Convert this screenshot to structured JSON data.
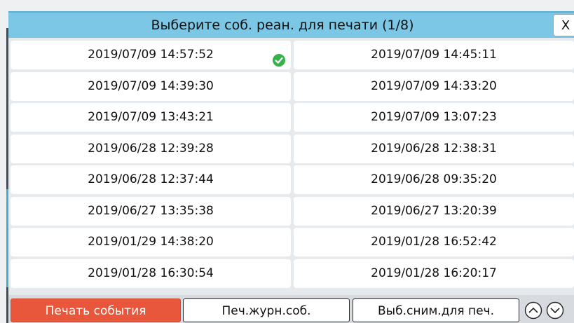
{
  "title": "Выберите соб. реан. для печати (1/8)",
  "close_label": "X",
  "events": [
    {
      "time": "2019/07/09 14:57:52",
      "selected": true
    },
    {
      "time": "2019/07/09 14:45:11",
      "selected": false
    },
    {
      "time": "2019/07/09 14:39:30",
      "selected": false
    },
    {
      "time": "2019/07/09 14:33:20",
      "selected": false
    },
    {
      "time": "2019/07/09 13:43:21",
      "selected": false
    },
    {
      "time": "2019/07/09 13:07:23",
      "selected": false
    },
    {
      "time": "2019/06/28 12:39:28",
      "selected": false
    },
    {
      "time": "2019/06/28 12:38:31",
      "selected": false
    },
    {
      "time": "2019/06/28 12:37:44",
      "selected": false
    },
    {
      "time": "2019/06/28 09:35:20",
      "selected": false
    },
    {
      "time": "2019/06/27 13:35:38",
      "selected": false
    },
    {
      "time": "2019/06/27 13:20:39",
      "selected": false
    },
    {
      "time": "2019/01/29 14:38:20",
      "selected": false
    },
    {
      "time": "2019/01/28 16:52:42",
      "selected": false
    },
    {
      "time": "2019/01/28 16:30:54",
      "selected": false
    },
    {
      "time": "2019/01/28 16:20:17",
      "selected": false
    }
  ],
  "footer": {
    "print_event": "Печать события",
    "print_log": "Печ.журн.соб.",
    "select_snapshot": "Выб.сним.для печ.",
    "up_icon": "chevron-up-circle",
    "down_icon": "chevron-down-circle"
  },
  "colors": {
    "titlebar": "#7cc7e6",
    "primary_button": "#e8573b",
    "check": "#35b34a"
  }
}
